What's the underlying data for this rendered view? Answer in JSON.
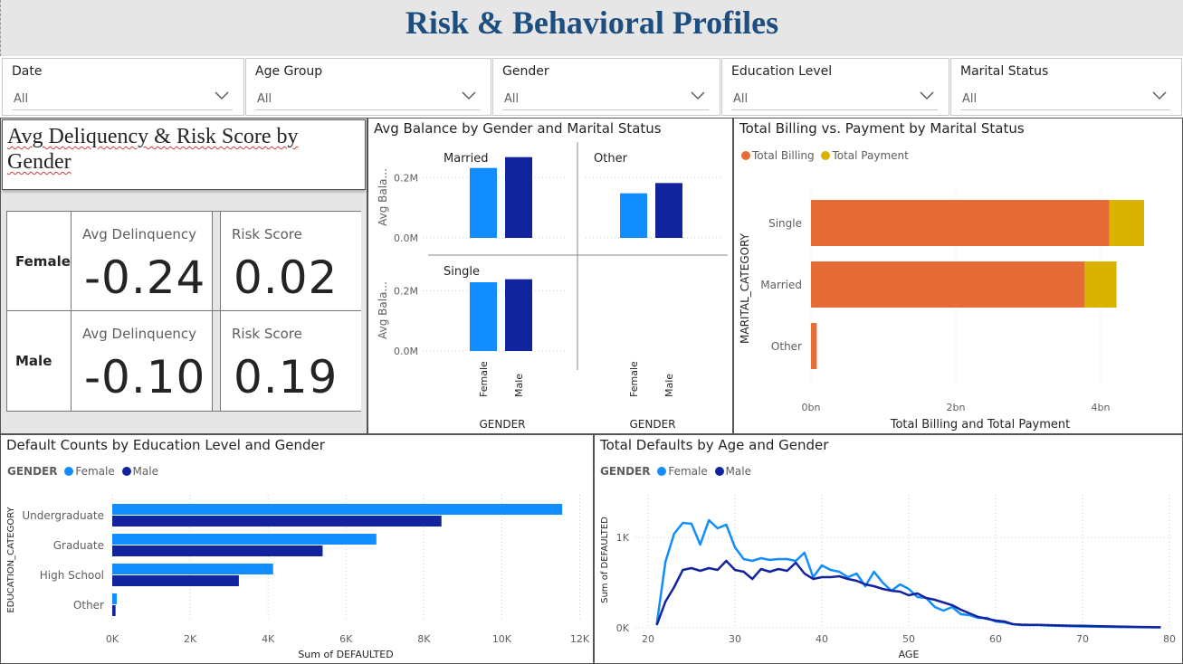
{
  "page": {
    "title": "Risk & Behavioral Profiles"
  },
  "slicers": [
    {
      "label": "Date",
      "value": "All"
    },
    {
      "label": "Age Group",
      "value": "All"
    },
    {
      "label": "Gender",
      "value": "All"
    },
    {
      "label": "Education Level",
      "value": "All"
    },
    {
      "label": "Marital Status",
      "value": "All"
    }
  ],
  "colors": {
    "female": "#118dff",
    "male": "#12239e",
    "billing": "#e66c37",
    "payment": "#d9b300",
    "header_bg": "#e6e6e6",
    "title": "#1c4e80"
  },
  "kpi_card": {
    "title": "Avg Deliquency & Risk Score by Gender",
    "rows": [
      {
        "gender": "Female",
        "avg_delinquency_label": "Avg Delinquency",
        "avg_delinquency": "-0.24",
        "risk_label": "Risk Score",
        "risk": "0.02"
      },
      {
        "gender": "Male",
        "avg_delinquency_label": "Avg Delinquency",
        "avg_delinquency": "-0.10",
        "risk_label": "Risk Score",
        "risk": "0.19"
      }
    ]
  },
  "chart_data": [
    {
      "type": "bar",
      "title": "Avg Balance by Gender and Marital Status",
      "ylabel": "Avg Bala...",
      "xlabel": "GENDER",
      "categories": [
        "Female",
        "Male"
      ],
      "yticks": [
        "0.0M",
        "0.2M"
      ],
      "ylim": [
        0,
        0.3
      ],
      "panels": [
        {
          "name": "Married",
          "values": [
            0.232,
            0.268
          ]
        },
        {
          "name": "Other",
          "values": [
            0.148,
            0.182
          ]
        },
        {
          "name": "Single",
          "values": [
            0.228,
            0.238
          ]
        }
      ]
    },
    {
      "type": "bar",
      "title": "Total Billing vs. Payment by Marital Status",
      "orientation": "horizontal-stacked",
      "ylabel": "MARITAL_CATEGORY",
      "xlabel": "Total Billing and Total Payment",
      "categories": [
        "Single",
        "Married",
        "Other"
      ],
      "series": [
        {
          "name": "Total Billing",
          "values": [
            4.12,
            3.78,
            0.08
          ]
        },
        {
          "name": "Total Payment",
          "values": [
            0.48,
            0.44,
            0.0
          ]
        }
      ],
      "xticks": [
        "0bn",
        "2bn",
        "4bn"
      ],
      "xlim": [
        0,
        5
      ],
      "legend": "top-left"
    },
    {
      "type": "bar",
      "title": "Default Counts by Education Level and Gender",
      "orientation": "horizontal",
      "legend_title": "GENDER",
      "ylabel": "EDUCATION_CATEGORY",
      "xlabel": "Sum of DEFAULTED",
      "categories": [
        "Undergraduate",
        "Graduate",
        "High School",
        "Other"
      ],
      "series": [
        {
          "name": "Female",
          "values": [
            11550,
            6780,
            4130,
            115
          ]
        },
        {
          "name": "Male",
          "values": [
            8450,
            5400,
            3250,
            85
          ]
        }
      ],
      "xticks": [
        "0K",
        "2K",
        "4K",
        "6K",
        "8K",
        "10K",
        "12K"
      ],
      "xlim": [
        0,
        12000
      ],
      "legend": "top-left"
    },
    {
      "type": "line",
      "title": "Total Defaults by Age and Gender",
      "legend_title": "GENDER",
      "xlabel": "AGE",
      "ylabel": "Sum of DEFAULTED",
      "xticks": [
        "20",
        "30",
        "40",
        "50",
        "60",
        "70",
        "80"
      ],
      "yticks": [
        "0K",
        "1K"
      ],
      "xlim": [
        19,
        80
      ],
      "ylim": [
        0,
        1300
      ],
      "x": [
        21,
        22,
        23,
        24,
        25,
        26,
        27,
        28,
        29,
        30,
        31,
        32,
        33,
        34,
        35,
        36,
        37,
        38,
        39,
        40,
        41,
        42,
        43,
        44,
        45,
        46,
        47,
        48,
        49,
        50,
        51,
        52,
        53,
        54,
        55,
        56,
        57,
        58,
        59,
        60,
        61,
        62,
        63,
        64,
        65,
        66,
        67,
        68,
        69,
        70,
        71,
        72,
        73,
        74,
        75,
        76,
        77,
        78,
        79
      ],
      "series": [
        {
          "name": "Female",
          "values": [
            40,
            730,
            1040,
            1160,
            1150,
            920,
            1190,
            1100,
            1140,
            890,
            760,
            740,
            770,
            750,
            760,
            760,
            740,
            830,
            560,
            690,
            640,
            620,
            560,
            600,
            460,
            620,
            500,
            410,
            480,
            430,
            340,
            330,
            230,
            190,
            230,
            150,
            140,
            110,
            110,
            70,
            60,
            40,
            30,
            30,
            30,
            25,
            22,
            20,
            18,
            15,
            14,
            12,
            10,
            9,
            8,
            7,
            6,
            5,
            5
          ]
        },
        {
          "name": "Male",
          "values": [
            30,
            290,
            450,
            640,
            660,
            630,
            660,
            640,
            740,
            640,
            620,
            540,
            650,
            620,
            650,
            630,
            720,
            600,
            540,
            560,
            560,
            570,
            540,
            520,
            480,
            460,
            430,
            410,
            400,
            360,
            380,
            330,
            310,
            280,
            250,
            200,
            160,
            120,
            100,
            80,
            70,
            40,
            35,
            33,
            33,
            30,
            28,
            25,
            22,
            22,
            20,
            18,
            16,
            14,
            12,
            10,
            9,
            8,
            6
          ]
        }
      ],
      "legend": "top-left"
    }
  ]
}
